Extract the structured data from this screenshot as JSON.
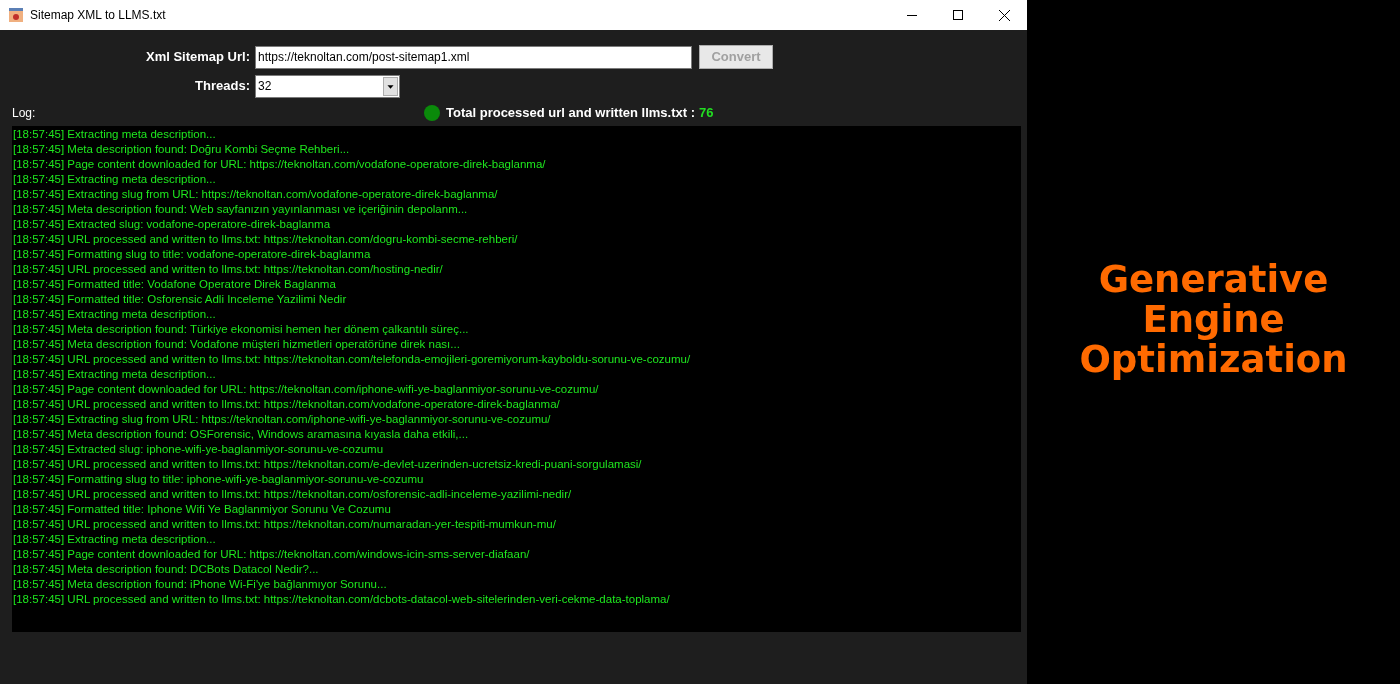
{
  "window": {
    "title": "Sitemap XML to LLMS.txt"
  },
  "form": {
    "url_label": "Xml Sitemap Url:",
    "url_value": "https://teknoltan.com/post-sitemap1.xml",
    "convert_button": {
      "label": "Convert",
      "disabled": true
    },
    "threads_label": "Threads:",
    "threads_value": "32"
  },
  "log_label": "Log:",
  "status": {
    "on": true,
    "label": "Total processed url and written llms.txt :",
    "count": "76"
  },
  "log": [
    "[18:57:45] Extracting meta description...",
    "[18:57:45] Meta description found: Doğru Kombi Seçme Rehberi...",
    "[18:57:45] Page content downloaded for URL: https://teknoltan.com/vodafone-operatore-direk-baglanma/",
    "[18:57:45] Extracting meta description...",
    "[18:57:45] Extracting slug from URL: https://teknoltan.com/vodafone-operatore-direk-baglanma/",
    "[18:57:45] Meta description found: Web sayfanızın yayınlanması ve içeriğinin depolanm...",
    "[18:57:45] Extracted slug: vodafone-operatore-direk-baglanma",
    "[18:57:45] URL processed and written to llms.txt: https://teknoltan.com/dogru-kombi-secme-rehberi/",
    "[18:57:45] Formatting slug to title: vodafone-operatore-direk-baglanma",
    "[18:57:45] URL processed and written to llms.txt: https://teknoltan.com/hosting-nedir/",
    "[18:57:45] Formatted title: Vodafone Operatore Direk Baglanma",
    "[18:57:45] Formatted title: Osforensic Adli Inceleme Yazilimi Nedir",
    "[18:57:45] Extracting meta description...",
    "[18:57:45] Meta description found: Türkiye ekonomisi hemen her dönem çalkantılı süreç...",
    "[18:57:45] Meta description found: Vodafone müşteri hizmetleri operatörüne direk nası...",
    "[18:57:45] URL processed and written to llms.txt: https://teknoltan.com/telefonda-emojileri-goremiyorum-kayboldu-sorunu-ve-cozumu/",
    "[18:57:45] Extracting meta description...",
    "[18:57:45] Page content downloaded for URL: https://teknoltan.com/iphone-wifi-ye-baglanmiyor-sorunu-ve-cozumu/",
    "[18:57:45] URL processed and written to llms.txt: https://teknoltan.com/vodafone-operatore-direk-baglanma/",
    "[18:57:45] Extracting slug from URL: https://teknoltan.com/iphone-wifi-ye-baglanmiyor-sorunu-ve-cozumu/",
    "[18:57:45] Meta description found: OSForensic, Windows aramasına kıyasla daha etkili,...",
    "[18:57:45] Extracted slug: iphone-wifi-ye-baglanmiyor-sorunu-ve-cozumu",
    "[18:57:45] URL processed and written to llms.txt: https://teknoltan.com/e-devlet-uzerinden-ucretsiz-kredi-puani-sorgulamasi/",
    "[18:57:45] Formatting slug to title: iphone-wifi-ye-baglanmiyor-sorunu-ve-cozumu",
    "[18:57:45] URL processed and written to llms.txt: https://teknoltan.com/osforensic-adli-inceleme-yazilimi-nedir/",
    "[18:57:45] Formatted title: Iphone Wifi Ye Baglanmiyor Sorunu Ve Cozumu",
    "[18:57:45] URL processed and written to llms.txt: https://teknoltan.com/numaradan-yer-tespiti-mumkun-mu/",
    "[18:57:45] Extracting meta description...",
    "[18:57:45] Page content downloaded for URL: https://teknoltan.com/windows-icin-sms-server-diafaan/",
    "[18:57:45] Meta description found: DCBots Datacol Nedir?...",
    "[18:57:45] Meta description found: iPhone Wi-Fi'ye bağlanmıyor  Sorunu...",
    "[18:57:45] URL processed and written to llms.txt: https://teknoltan.com/dcbots-datacol-web-sitelerinden-veri-cekme-data-toplama/"
  ],
  "promo": {
    "lines": [
      "Generative",
      "Engine",
      "Optimization"
    ]
  }
}
